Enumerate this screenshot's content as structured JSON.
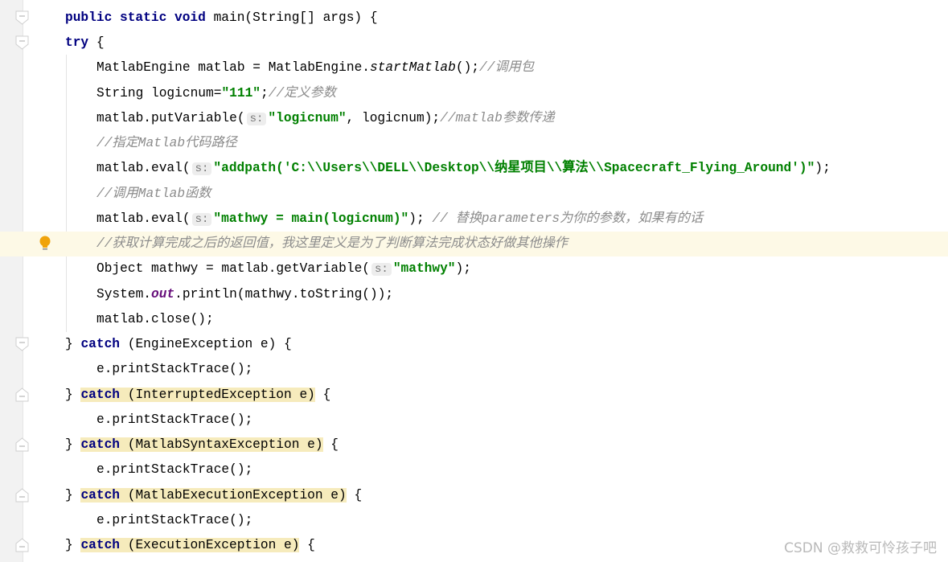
{
  "editor": {
    "lines": [
      {
        "indent": 0,
        "fold": "open",
        "tokens": [
          {
            "t": "public static void ",
            "c": "kw"
          },
          {
            "t": "main(String[] args) {",
            "c": ""
          }
        ]
      },
      {
        "indent": 0,
        "fold": "open",
        "tokens": [
          {
            "t": "try",
            "c": "kw"
          },
          {
            "t": " {",
            "c": ""
          }
        ]
      },
      {
        "indent": 1,
        "tokens": [
          {
            "t": "MatlabEngine matlab = MatlabEngine.",
            "c": ""
          },
          {
            "t": "startMatlab",
            "c": "it"
          },
          {
            "t": "();",
            "c": ""
          },
          {
            "t": "//调用包",
            "c": "cm"
          }
        ]
      },
      {
        "indent": 1,
        "tokens": [
          {
            "t": "String logicnum=",
            "c": ""
          },
          {
            "t": "\"111\"",
            "c": "str"
          },
          {
            "t": ";",
            "c": ""
          },
          {
            "t": "//定义参数",
            "c": "cm"
          }
        ]
      },
      {
        "indent": 1,
        "tokens": [
          {
            "t": "matlab.putVariable(",
            "c": ""
          },
          {
            "t": "s:",
            "c": "hint"
          },
          {
            "t": "\"logicnum\"",
            "c": "str"
          },
          {
            "t": ", logicnum);",
            "c": ""
          },
          {
            "t": "//matlab参数传递",
            "c": "cm"
          }
        ]
      },
      {
        "indent": 1,
        "tokens": [
          {
            "t": "//指定Matlab代码路径",
            "c": "cm"
          }
        ]
      },
      {
        "indent": 1,
        "tokens": [
          {
            "t": "matlab.eval(",
            "c": ""
          },
          {
            "t": "s:",
            "c": "hint"
          },
          {
            "t": "\"addpath('C:\\\\Users\\\\DELL\\\\Desktop\\\\纳星项目\\\\算法\\\\Spacecraft_Flying_Around')\"",
            "c": "str"
          },
          {
            "t": ");",
            "c": ""
          }
        ]
      },
      {
        "indent": 1,
        "tokens": [
          {
            "t": "//调用Matlab函数",
            "c": "cm"
          }
        ]
      },
      {
        "indent": 1,
        "tokens": [
          {
            "t": "matlab.eval(",
            "c": ""
          },
          {
            "t": "s:",
            "c": "hint"
          },
          {
            "t": "\"mathwy = main(logicnum)\"",
            "c": "str"
          },
          {
            "t": "); ",
            "c": ""
          },
          {
            "t": "// 替换parameters为你的参数，如果有的话",
            "c": "cm"
          }
        ]
      },
      {
        "indent": 1,
        "current": true,
        "bulb": true,
        "tokens": [
          {
            "t": "//获取计算完成之后的返回值，我这里定义是为了判断算法完成状态好做其他操作",
            "c": "cm"
          }
        ]
      },
      {
        "indent": 1,
        "tokens": [
          {
            "t": "Object mathwy = matlab.getVariable(",
            "c": ""
          },
          {
            "t": "s:",
            "c": "hint"
          },
          {
            "t": "\"mathwy\"",
            "c": "str"
          },
          {
            "t": ");",
            "c": ""
          }
        ]
      },
      {
        "indent": 1,
        "tokens": [
          {
            "t": "System.",
            "c": ""
          },
          {
            "t": "out",
            "c": "field"
          },
          {
            "t": ".println(mathwy.toString());",
            "c": ""
          }
        ]
      },
      {
        "indent": 1,
        "tokens": [
          {
            "t": "matlab.close();",
            "c": ""
          }
        ]
      },
      {
        "indent": 0,
        "fold": "open",
        "tokens": [
          {
            "t": "} ",
            "c": ""
          },
          {
            "t": "catch",
            "c": "kw"
          },
          {
            "t": " (EngineException e) {",
            "c": ""
          }
        ]
      },
      {
        "indent": 1,
        "tokens": [
          {
            "t": "e.printStackTrace();",
            "c": ""
          }
        ]
      },
      {
        "indent": 0,
        "fold": "close",
        "hl": true,
        "tokens": [
          {
            "t": "} ",
            "c": ""
          },
          {
            "t": "catch",
            "c": "kw hl"
          },
          {
            "t": " (InterruptedException e)",
            "c": "hl"
          },
          {
            "t": " {",
            "c": ""
          }
        ]
      },
      {
        "indent": 1,
        "tokens": [
          {
            "t": "e.printStackTrace();",
            "c": ""
          }
        ]
      },
      {
        "indent": 0,
        "fold": "close",
        "tokens": [
          {
            "t": "} ",
            "c": ""
          },
          {
            "t": "catch",
            "c": "kw hl"
          },
          {
            "t": " (MatlabSyntaxException e)",
            "c": "hl"
          },
          {
            "t": " {",
            "c": ""
          }
        ]
      },
      {
        "indent": 1,
        "tokens": [
          {
            "t": "e.printStackTrace();",
            "c": ""
          }
        ]
      },
      {
        "indent": 0,
        "fold": "close",
        "tokens": [
          {
            "t": "} ",
            "c": ""
          },
          {
            "t": "catch",
            "c": "kw hl"
          },
          {
            "t": " (MatlabExecutionException e)",
            "c": "hl"
          },
          {
            "t": " {",
            "c": ""
          }
        ]
      },
      {
        "indent": 1,
        "tokens": [
          {
            "t": "e.printStackTrace();",
            "c": ""
          }
        ]
      },
      {
        "indent": 0,
        "fold": "close",
        "tokens": [
          {
            "t": "} ",
            "c": ""
          },
          {
            "t": "catch",
            "c": "kw hl"
          },
          {
            "t": " (ExecutionException e)",
            "c": "hl"
          },
          {
            "t": " {",
            "c": ""
          }
        ]
      }
    ]
  },
  "colors": {
    "keyword": "#000080",
    "string": "#008000",
    "comment": "#8c8c8c",
    "field": "#660e7a",
    "caret_row": "#fdf9e6",
    "match_highlight": "#f6ebbc",
    "bulb": "#f0a30a"
  },
  "icons": {
    "fold_open": "fold-open-icon",
    "fold_close": "fold-close-icon",
    "bulb": "lightbulb-icon"
  },
  "watermark": "CSDN @救救可怜孩子吧"
}
